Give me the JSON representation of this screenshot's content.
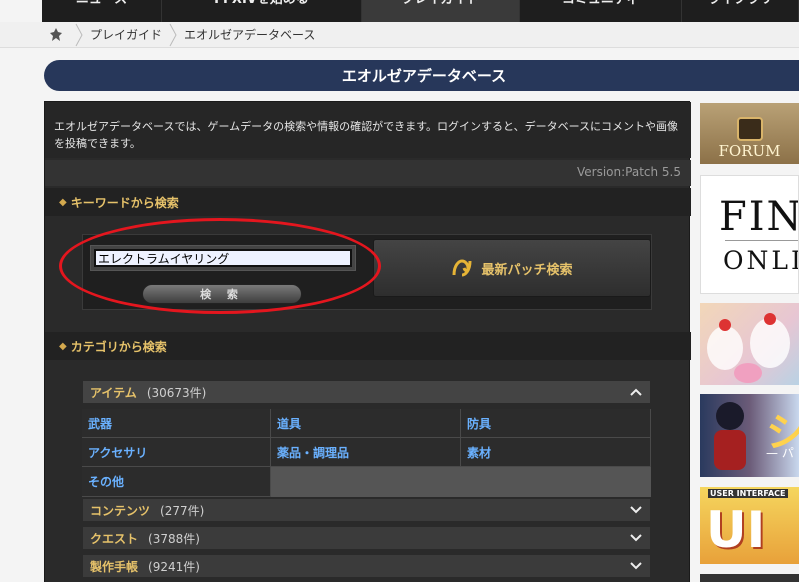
{
  "topnav": {
    "tabs": [
      {
        "label": "ニュース"
      },
      {
        "label": "FFXIVを始める"
      },
      {
        "label": "プレイガイド"
      },
      {
        "label": "コミュニティ"
      },
      {
        "label": "ライブラリ"
      }
    ]
  },
  "breadcrumb": {
    "items": [
      "プレイガイド",
      "エオルゼアデータベース"
    ]
  },
  "page": {
    "title": "エオルゼアデータベース",
    "intro": "エオルゼアデータベースでは、ゲームデータの検索や情報の確認ができます。ログインすると、データベースにコメントや画像を投稿できます。",
    "version": "Version:Patch 5.5"
  },
  "keyword_search": {
    "heading": "キーワードから検索",
    "input_value": "エレクトラムイヤリング",
    "search_button": "検 索",
    "patch_button": "最新パッチ検索"
  },
  "category_search": {
    "heading": "カテゴリから検索",
    "categories": [
      {
        "label": "アイテム",
        "count": "(30673件)",
        "expanded": true
      },
      {
        "label": "コンテンツ",
        "count": "(277件)",
        "expanded": false
      },
      {
        "label": "クエスト",
        "count": "(3788件)",
        "expanded": false
      },
      {
        "label": "製作手帳",
        "count": "(9241件)",
        "expanded": false
      }
    ],
    "item_subcategories": [
      "武器",
      "道具",
      "防具",
      "アクセサリ",
      "薬品・調理品",
      "素材",
      "その他"
    ]
  },
  "sidebar": {
    "forum_label": "FORUM",
    "ff_line1": "FINAL",
    "ff_line2": "ONLI",
    "pirate_text": "シ",
    "pirate_sub": "— パ",
    "ui_small": "USER INTERFACE",
    "ui_big": "UI"
  },
  "colors": {
    "title_bar": "#27375a",
    "gold_text": "#e6c26a",
    "link_blue": "#6ab1ff",
    "highlight_red": "#e4161e"
  }
}
